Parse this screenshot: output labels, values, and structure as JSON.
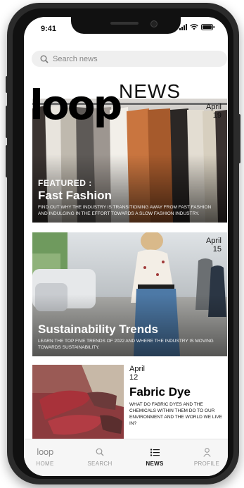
{
  "status_bar": {
    "time": "9:41"
  },
  "search": {
    "placeholder": "Search news"
  },
  "header": {
    "logo_text": "loop",
    "section_title": "NEWS"
  },
  "articles": [
    {
      "date_month": "April",
      "date_day": "19",
      "tag": "FEATURED :",
      "title": "Fast Fashion",
      "description": "FIND OUT WHY THE INDUSTRY IS TRANSITIONING AWAY FROM FAST FASHION AND INDULGING IN THE EFFORT TOWARDS A SLOW FASHION INDUSTRY."
    },
    {
      "date_month": "April",
      "date_day": "15",
      "title": "Sustainability Trends",
      "description": "LEARN THE TOP FIVE TRENDS OF 2022 AND WHERE THE INDUSTRY IS MOVING TOWARDS SUSTAINABILITY."
    },
    {
      "date_month": "April",
      "date_day": "12",
      "title": "Fabric Dye",
      "description": "WHAT DO FABRIC DYES AND THE CHEMICALS WITHIN THEM DO TO OUR ENVIRONMENT AND THE WORLD WE LIVE IN?"
    }
  ],
  "tab_bar": {
    "home_logo": "loop",
    "tabs": [
      {
        "label": "HOME",
        "icon": "loop-logo-icon"
      },
      {
        "label": "SEARCH",
        "icon": "search-icon"
      },
      {
        "label": "NEWS",
        "icon": "news-list-icon",
        "active": true
      },
      {
        "label": "PROFILE",
        "icon": "person-icon"
      }
    ]
  },
  "colors": {
    "accent": "#111111",
    "inactive": "#9a9a9a",
    "search_bg": "#efefef"
  }
}
